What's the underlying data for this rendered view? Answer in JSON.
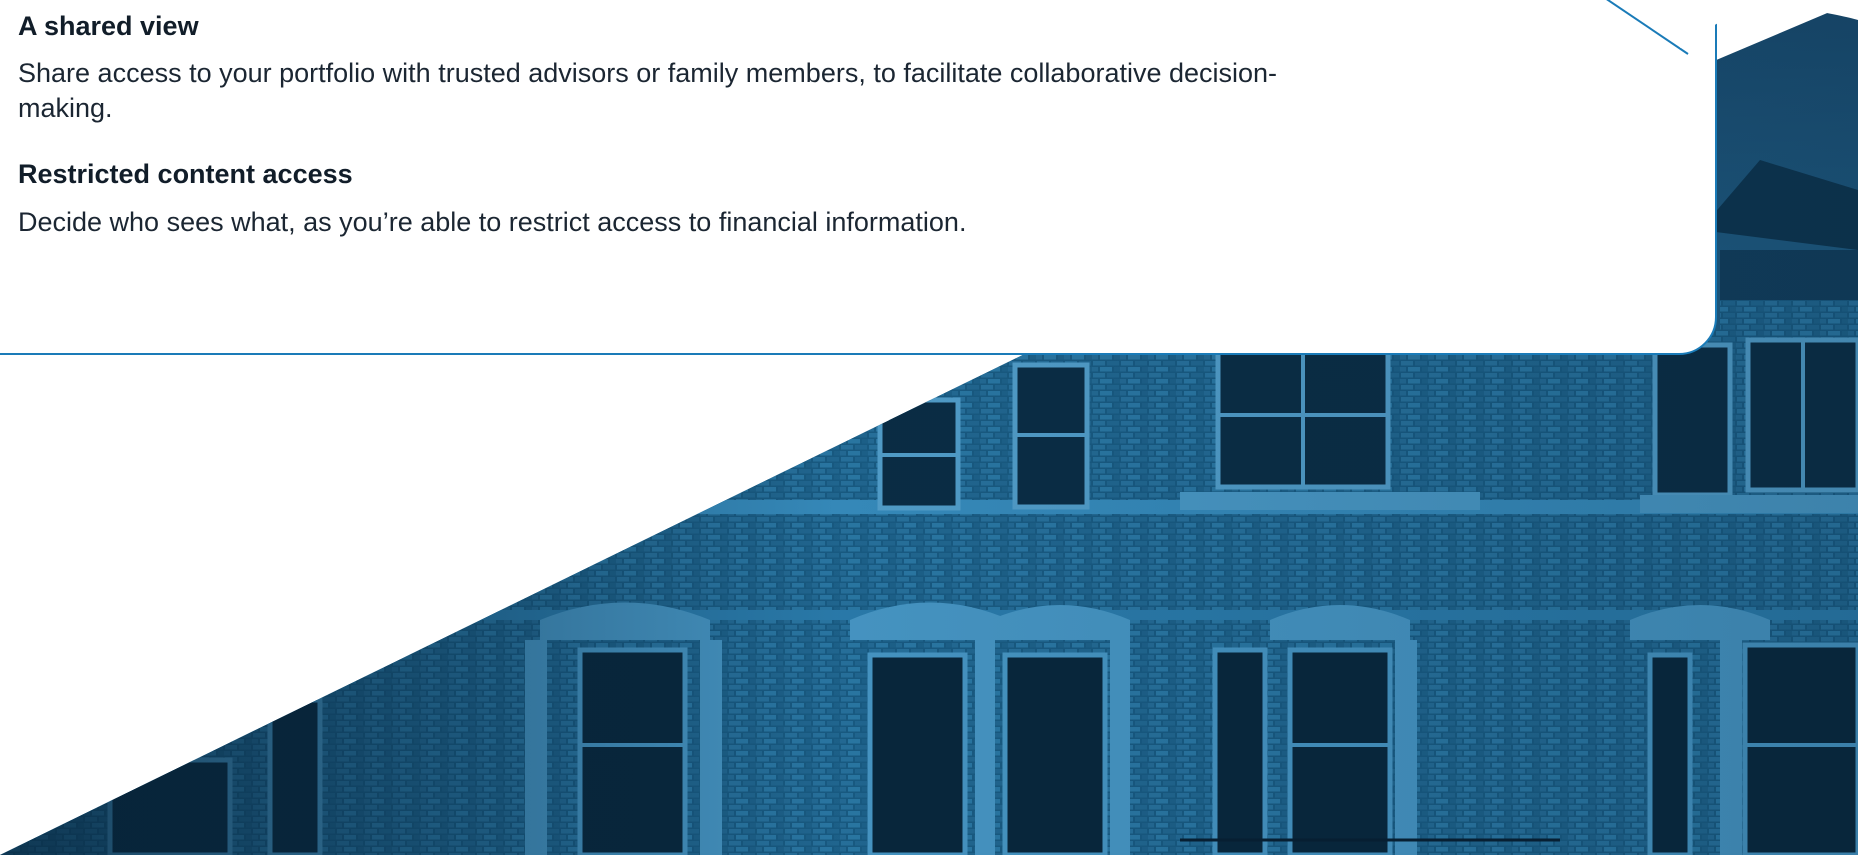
{
  "features": [
    {
      "title": "A shared view",
      "description": "Share access to your portfolio with trusted advisors or family members, to facilitate collaborative decision-making."
    },
    {
      "title": "Restricted content access",
      "description": "Decide who sees what, as you’re able to restrict access to financial information."
    }
  ],
  "colors": {
    "accent": "#1a7bb8",
    "photo_tint": "#0f5c8a",
    "text": "#111d29"
  }
}
